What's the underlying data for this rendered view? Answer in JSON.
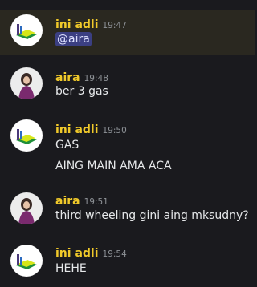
{
  "messages": [
    {
      "author": "ini adli",
      "time": "19:47",
      "mention": "@aira",
      "lines": []
    },
    {
      "author": "aira",
      "time": "19:48",
      "lines": [
        "ber 3 gas"
      ]
    },
    {
      "author": "ini adli",
      "time": "19:50",
      "lines": [
        "GAS",
        "AING MAIN AMA ACA"
      ]
    },
    {
      "author": "aira",
      "time": "19:51",
      "lines": [
        "third wheeling gini aing mksudny?"
      ]
    },
    {
      "author": "ini adli",
      "time": "19:54",
      "lines": [
        "HEHE"
      ]
    }
  ],
  "colors": {
    "background": "#1a1a1e",
    "highlight": "#2a2820",
    "author": "#f0c92a",
    "mention_bg": "#3b3f82",
    "text": "#e6e8ea"
  }
}
